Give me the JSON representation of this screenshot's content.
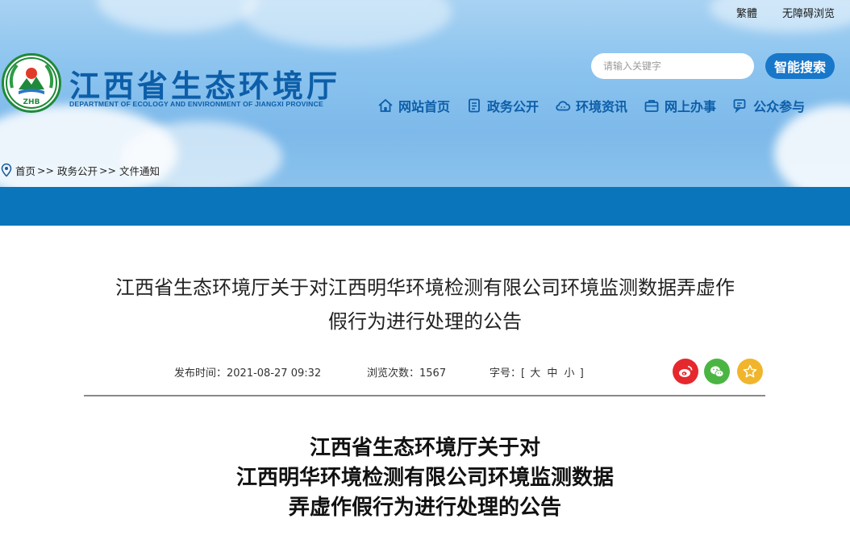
{
  "topbar": {
    "traditional_label": "繁體",
    "accessibility_label": "无障碍浏览"
  },
  "site": {
    "title": "江西省生态环境厅",
    "subtitle": "DEPARTMENT OF ECOLOGY AND ENVIRONMENT OF JIANGXI PROVINCE",
    "logo_text": "ZHB"
  },
  "search": {
    "placeholder": "请输入关键字",
    "button_label": "智能搜索"
  },
  "nav": [
    {
      "label": "网站首页",
      "icon": "home-icon"
    },
    {
      "label": "政务公开",
      "icon": "document-icon"
    },
    {
      "label": "环境资讯",
      "icon": "cloud-icon"
    },
    {
      "label": "网上办事",
      "icon": "briefcase-icon"
    },
    {
      "label": "公众参与",
      "icon": "chat-icon"
    }
  ],
  "breadcrumb": {
    "icon": "location-pin-icon",
    "items": [
      "首页",
      "政务公开",
      "文件通知"
    ],
    "separator": ">>"
  },
  "article": {
    "title_line1": "江西省生态环境厅关于对江西明华环境检测有限公司环境监测数据弄虚作",
    "title_line2": "假行为进行处理的公告",
    "publish_label": "发布时间：",
    "publish_time": "2021-08-27 09:32",
    "views_label": "浏览次数：",
    "views": "1567",
    "fontsize_label": "字号：[",
    "fontsize_large": "大",
    "fontsize_medium": "中",
    "fontsize_small": "小",
    "fontsize_close": "]",
    "share": [
      {
        "name": "weibo",
        "icon": "weibo-icon",
        "color": "#e6282c"
      },
      {
        "name": "wechat",
        "icon": "wechat-icon",
        "color": "#4bb544"
      },
      {
        "name": "favorite",
        "icon": "star-icon",
        "color": "#f1b52c"
      }
    ],
    "doc_heading": [
      "江西省生态环境厅关于对",
      "江西明华环境检测有限公司环境监测数据",
      "弄虚作假行为进行处理的公告"
    ]
  },
  "colors": {
    "brand_blue": "#0d5ea8",
    "band_blue": "#0b75bb",
    "search_button": "#1877c9"
  }
}
